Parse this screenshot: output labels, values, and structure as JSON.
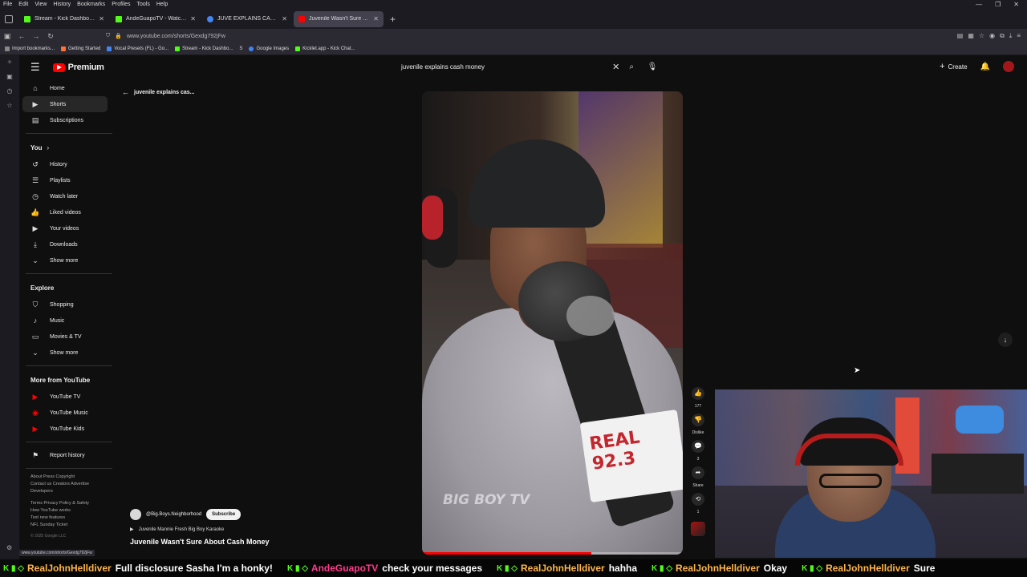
{
  "menubar": {
    "items": [
      "File",
      "Edit",
      "View",
      "History",
      "Bookmarks",
      "Profiles",
      "Tools",
      "Help"
    ],
    "win_controls": [
      "—",
      "❐",
      "✕"
    ]
  },
  "tabs": [
    {
      "label": "Stream - Kick Dashboard",
      "color": "#53fc18"
    },
    {
      "label": "AndeGuapoTV - Watch the VOD",
      "color": "#53fc18"
    },
    {
      "label": "JUVE EXPLAINS CASH MONEY",
      "color": "#4285f4"
    },
    {
      "label": "Juvenile Wasn't Sure About Cash Money",
      "color": "#ff0000"
    }
  ],
  "url": "www.youtube.com/shorts/Gexdg792jFw",
  "bookmarks": [
    "Import bookmarks...",
    "Getting Started",
    "Vocal Presets (FL) - Go...",
    "Stream - Kick Dashbo...",
    "S",
    "Google Images",
    "Kicklet.app - Kick Chat..."
  ],
  "yt": {
    "logo_text": "Premium",
    "search_query": "juvenile explains cash money",
    "create_label": "Create",
    "back_query": "juvenile explains cas...",
    "sidebar": {
      "main": [
        {
          "label": "Home",
          "icon": "⌂"
        },
        {
          "label": "Shorts",
          "icon": "▶"
        },
        {
          "label": "Subscriptions",
          "icon": "▤"
        }
      ],
      "you_heading": "You",
      "you_items": [
        {
          "label": "History",
          "icon": "↺"
        },
        {
          "label": "Playlists",
          "icon": "☰"
        },
        {
          "label": "Watch later",
          "icon": "◷"
        },
        {
          "label": "Liked videos",
          "icon": "👍"
        },
        {
          "label": "Your videos",
          "icon": "▶"
        },
        {
          "label": "Downloads",
          "icon": "⤓"
        },
        {
          "label": "Show more",
          "icon": "⌄"
        }
      ],
      "explore_heading": "Explore",
      "explore_items": [
        {
          "label": "Shopping",
          "icon": "⛉"
        },
        {
          "label": "Music",
          "icon": "♪"
        },
        {
          "label": "Movies & TV",
          "icon": "▭"
        },
        {
          "label": "Show more",
          "icon": "⌄"
        }
      ],
      "more_heading": "More from YouTube",
      "more_items": [
        {
          "label": "YouTube TV",
          "icon": "▶"
        },
        {
          "label": "YouTube Music",
          "icon": "◉"
        },
        {
          "label": "YouTube Kids",
          "icon": "▶"
        }
      ],
      "report": {
        "label": "Report history",
        "icon": "⚑"
      },
      "footer1": "About  Press  Copyright",
      "footer2": "Contact us  Creators  Advertise",
      "footer3": "Developers",
      "footer4": "Terms  Privacy  Policy & Safety",
      "footer5": "How YouTube works",
      "footer6": "Test new features",
      "footer7": "NFL Sunday Ticket",
      "copyright": "© 2025 Google LLC"
    },
    "video": {
      "brand_overlay": "BIG BOY TV",
      "flag_text": "REAL 92.3",
      "progress": 0.65
    },
    "actions": {
      "like_count": "177",
      "dislike_label": "Dislike",
      "comment_count": "3",
      "share_label": "Share",
      "remix_count": "1"
    },
    "channel": "@Big.Boys.Neighborhood",
    "subscribe_label": "Subscribe",
    "music": "Juvenile Mannie Fresh Big Boy Karaoke",
    "short_title": "Juvenile Wasn't Sure About Cash Money",
    "status_url": "www.youtube.com/shorts/Gexdg792jFw"
  },
  "ticker": [
    {
      "user": "RealJohnHelldiver",
      "msg": "Full disclosure Sasha I'm a honky!",
      "pink": false
    },
    {
      "user": "AndeGuapoTV",
      "msg": "check your messages",
      "pink": true
    },
    {
      "user": "RealJohnHelldiver",
      "msg": "hahha",
      "pink": false
    },
    {
      "user": "RealJohnHelldiver",
      "msg": "Okay",
      "pink": false
    },
    {
      "user": "RealJohnHelldiver",
      "msg": "Sure",
      "pink": false
    }
  ]
}
